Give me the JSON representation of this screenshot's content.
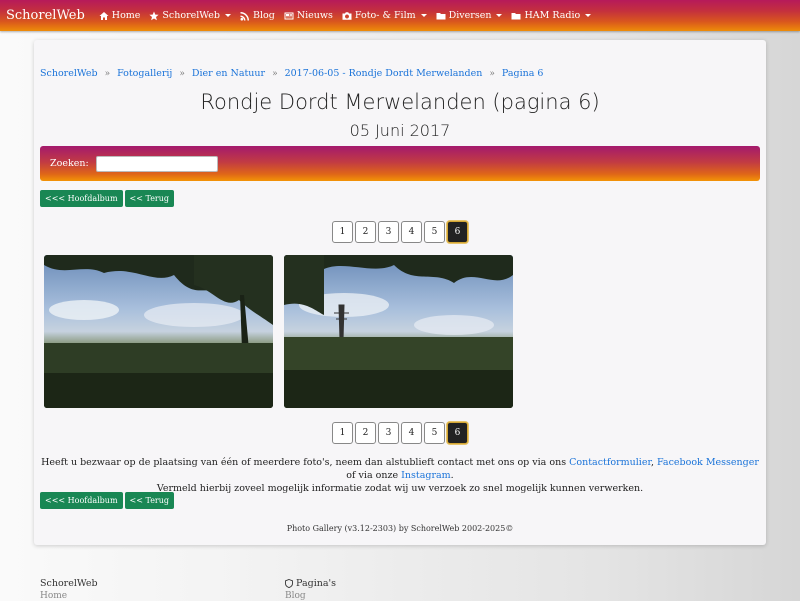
{
  "navbar": {
    "brand": "SchorelWeb",
    "items": [
      {
        "label": "Home",
        "icon": "home-icon",
        "dropdown": false
      },
      {
        "label": "SchorelWeb",
        "icon": "star-icon",
        "dropdown": true
      },
      {
        "label": "Blog",
        "icon": "rss-icon",
        "dropdown": false
      },
      {
        "label": "Nieuws",
        "icon": "newspaper-icon",
        "dropdown": false
      },
      {
        "label": "Foto- & Film",
        "icon": "camera-icon",
        "dropdown": true
      },
      {
        "label": "Diversen",
        "icon": "folder-icon",
        "dropdown": true
      },
      {
        "label": "HAM Radio",
        "icon": "folder-icon",
        "dropdown": true
      }
    ]
  },
  "breadcrumb": [
    "SchorelWeb",
    "Fotogallerij",
    "Dier en Natuur",
    "2017-06-05 - Rondje Dordt Merwelanden",
    "Pagina 6"
  ],
  "page": {
    "title": "Rondje Dordt Merwelanden (pagina 6)",
    "date": "05 Juni 2017"
  },
  "search": {
    "label": "Zoeken:",
    "value": ""
  },
  "buttons": {
    "main_album": "<<< Hoofdalbum",
    "back": "<< Terug"
  },
  "pagination": {
    "pages": [
      "1",
      "2",
      "3",
      "4",
      "5",
      "6"
    ],
    "current": "6"
  },
  "notice": {
    "text1": "Heeft u bezwaar op de plaatsing van één of meerdere foto's, neem dan alstublieft contact met ons op via ons ",
    "link1": "Contactformulier",
    "text2": ", ",
    "link2": "Facebook Messenger",
    "text3": " of via onze ",
    "link3": "Instagram",
    "text4": ".",
    "line2": "Vermeld hierbij zoveel mogelijk informatie zodat wij uw verzoek zo snel mogelijk kunnen verwerken."
  },
  "credits": "Photo Gallery (v3.12-2303) by SchorelWeb 2002-2025©",
  "footer": {
    "col1_title": "SchorelWeb",
    "col1_item": "Home",
    "col2_title": "Pagina's",
    "col2_item": "Blog"
  }
}
